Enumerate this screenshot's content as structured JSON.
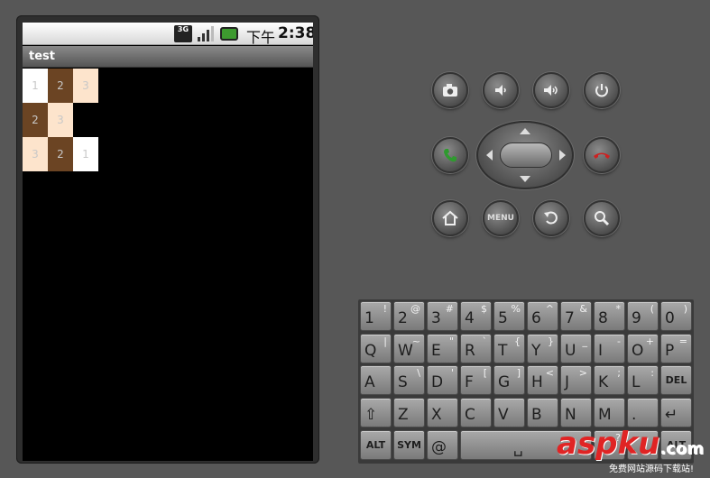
{
  "status_bar": {
    "network_label": "3G",
    "clock_label": "下午",
    "time": "2:38"
  },
  "app": {
    "title": "test"
  },
  "grid": {
    "rows": [
      [
        {
          "text": "1",
          "bg": "#ffffff",
          "fg": "#c8c8c8"
        },
        {
          "text": "2",
          "bg": "#6b4423",
          "fg": "#c8c8c8"
        },
        {
          "text": "3",
          "bg": "#fde4cc",
          "fg": "#c8c8c8"
        }
      ],
      [
        {
          "text": "2",
          "bg": "#6b4423",
          "fg": "#c8c8c8"
        },
        {
          "text": "3",
          "bg": "#fde4cc",
          "fg": "#c8c8c8"
        }
      ],
      [
        {
          "text": "3",
          "bg": "#fde4cc",
          "fg": "#c8c8c8"
        },
        {
          "text": "2",
          "bg": "#6b4423",
          "fg": "#c8c8c8"
        },
        {
          "text": "1",
          "bg": "#ffffff",
          "fg": "#c8c8c8"
        }
      ]
    ]
  },
  "controls": {
    "menu_label": "MENU"
  },
  "keyboard": {
    "rows": [
      [
        {
          "main": "1",
          "alt": "!"
        },
        {
          "main": "2",
          "alt": "@"
        },
        {
          "main": "3",
          "alt": "#"
        },
        {
          "main": "4",
          "alt": "$"
        },
        {
          "main": "5",
          "alt": "%"
        },
        {
          "main": "6",
          "alt": "^"
        },
        {
          "main": "7",
          "alt": "&"
        },
        {
          "main": "8",
          "alt": "*"
        },
        {
          "main": "9",
          "alt": "("
        },
        {
          "main": "0",
          "alt": ")"
        }
      ],
      [
        {
          "main": "Q",
          "alt": "|"
        },
        {
          "main": "W",
          "alt": "~"
        },
        {
          "main": "E",
          "alt": "\""
        },
        {
          "main": "R",
          "alt": "`"
        },
        {
          "main": "T",
          "alt": "{"
        },
        {
          "main": "Y",
          "alt": "}"
        },
        {
          "main": "U",
          "alt": "_"
        },
        {
          "main": "I",
          "alt": "-"
        },
        {
          "main": "O",
          "alt": "+"
        },
        {
          "main": "P",
          "alt": "="
        }
      ],
      [
        {
          "main": "A",
          "alt": ""
        },
        {
          "main": "S",
          "alt": "\\"
        },
        {
          "main": "D",
          "alt": "'"
        },
        {
          "main": "F",
          "alt": "["
        },
        {
          "main": "G",
          "alt": "]"
        },
        {
          "main": "H",
          "alt": "<"
        },
        {
          "main": "J",
          "alt": ">"
        },
        {
          "main": "K",
          "alt": ";"
        },
        {
          "main": "L",
          "alt": ":"
        },
        {
          "main": "DEL",
          "alt": ""
        }
      ],
      [
        {
          "main": "⇧",
          "alt": ""
        },
        {
          "main": "Z",
          "alt": ""
        },
        {
          "main": "X",
          "alt": ""
        },
        {
          "main": "C",
          "alt": ""
        },
        {
          "main": "V",
          "alt": ""
        },
        {
          "main": "B",
          "alt": ""
        },
        {
          "main": "N",
          "alt": ""
        },
        {
          "main": "M",
          "alt": ""
        },
        {
          "main": ".",
          "alt": ""
        },
        {
          "main": "↵",
          "alt": ""
        }
      ],
      [
        {
          "main": "ALT",
          "alt": ""
        },
        {
          "main": "SYM",
          "alt": ""
        },
        {
          "main": "@",
          "alt": ""
        },
        {
          "main": "␣",
          "alt": ""
        },
        {
          "main": "/",
          "alt": "?"
        },
        {
          "main": ",",
          "alt": ""
        },
        {
          "main": "ALT",
          "alt": ""
        }
      ]
    ]
  },
  "watermark": {
    "brand": "aspku",
    "tld": ".com",
    "tagline": "免费网站源码下载站!"
  },
  "colors": {
    "call_green": "#2f9a2f",
    "end_red": "#cc2222",
    "brand_red": "#e02424"
  }
}
